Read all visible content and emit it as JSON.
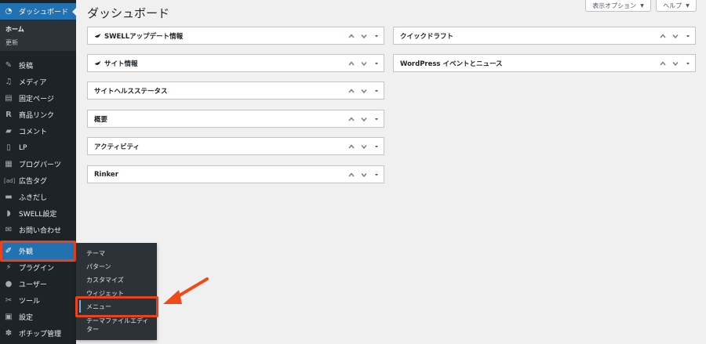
{
  "sidebar": {
    "dashboard": {
      "label": "ダッシュボード",
      "icon": "dashboard-icon"
    },
    "submenu": [
      {
        "label": "ホーム"
      },
      {
        "label": "更新"
      }
    ],
    "items": [
      {
        "label": "投稿",
        "icon": "pin-icon"
      },
      {
        "label": "メディア",
        "icon": "media-icon"
      },
      {
        "label": "固定ページ",
        "icon": "page-icon"
      },
      {
        "label": "商品リンク",
        "icon": "r-icon"
      },
      {
        "label": "コメント",
        "icon": "comment-icon"
      },
      {
        "label": "LP",
        "icon": "document-icon"
      },
      {
        "label": "ブログパーツ",
        "icon": "layout-icon"
      },
      {
        "label": "広告タグ",
        "icon": "ad-icon"
      },
      {
        "label": "ふきだし",
        "icon": "balloon-icon"
      },
      {
        "label": "SWELL設定",
        "icon": "swell-icon"
      },
      {
        "label": "お問い合わせ",
        "icon": "mail-icon"
      },
      {
        "label": "外観",
        "icon": "paintbrush-icon"
      },
      {
        "label": "プラグイン",
        "icon": "plugin-icon"
      },
      {
        "label": "ユーザー",
        "icon": "user-icon"
      },
      {
        "label": "ツール",
        "icon": "wrench-icon"
      },
      {
        "label": "設定",
        "icon": "settings-icon"
      },
      {
        "label": "ポチップ管理",
        "icon": "paw-icon"
      }
    ]
  },
  "flyout": {
    "items": [
      {
        "label": "テーマ"
      },
      {
        "label": "パターン"
      },
      {
        "label": "カスタマイズ"
      },
      {
        "label": "ウィジェット"
      },
      {
        "label": "メニュー"
      },
      {
        "label": "テーマファイルエディ"
      },
      {
        "label": "ター"
      }
    ]
  },
  "header": {
    "title": "ダッシュボード",
    "screen_options": "表示オプション",
    "help": "ヘルプ"
  },
  "widgets": {
    "left": [
      {
        "title": "SWELLアップデート情報",
        "logo": true
      },
      {
        "title": "サイト情報",
        "logo": true
      },
      {
        "title": "サイトヘルスステータス",
        "logo": false
      },
      {
        "title": "概要",
        "logo": false
      },
      {
        "title": "アクティビティ",
        "logo": false
      },
      {
        "title": "Rinker",
        "logo": false
      }
    ],
    "right": [
      {
        "title": "クイックドラフト"
      },
      {
        "title": "WordPress イベントとニュース"
      }
    ]
  },
  "colors": {
    "sidebar_bg": "#1d2327",
    "submenu_bg": "#2c3338",
    "active": "#2271b1",
    "highlight": "#e8421f",
    "page_bg": "#f0f0f1"
  }
}
